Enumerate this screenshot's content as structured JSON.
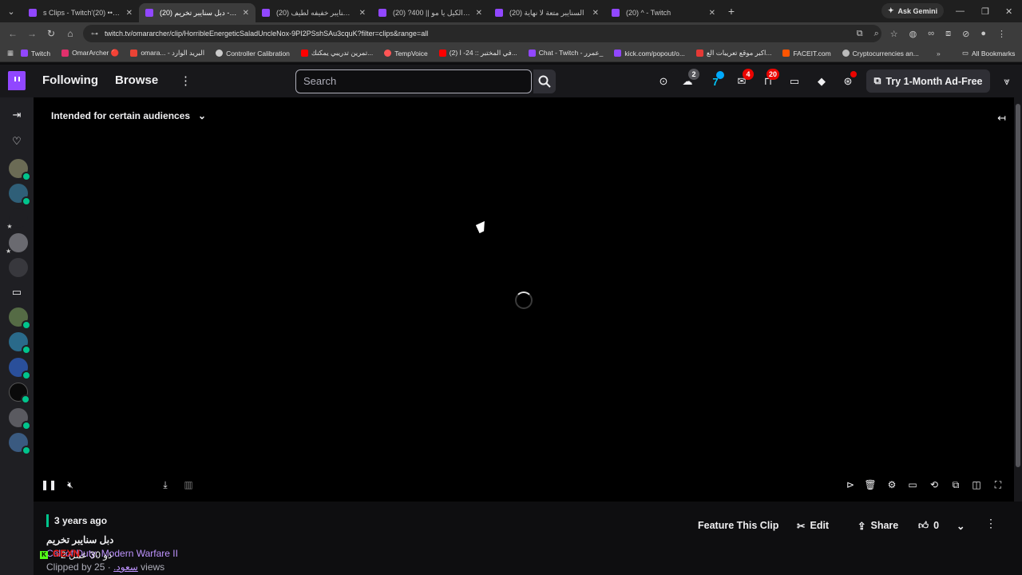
{
  "browser": {
    "tabs": [
      {
        "title": "s Clips - Twitch'عمر•• (20)",
        "active": false
      },
      {
        "title": "(20) دبل سنايبر تخريم - witch",
        "active": true
      },
      {
        "title": "(20) لقطة سنايبر خفيفه لطيف",
        "active": false
      },
      {
        "title": "(20) ?400 || طفع الكيل يا مو",
        "active": false
      },
      {
        "title": "(20) السنايبر متعة لا نهاية",
        "active": false
      },
      {
        "title": "(20) ^ - Twitch",
        "active": false
      }
    ],
    "ask_gemini": "Ask Gemini",
    "url": "twitch.tv/omararcher/clip/HorribleEnergeticSaladUncleNox-9PI2PSshSAu3cquK?filter=clips&range=all",
    "bookmarks": [
      {
        "label": "Twitch",
        "color": "#9147ff"
      },
      {
        "label": "OmarArcher 🔴",
        "color": "#e1306c"
      },
      {
        "label": "omara... - البريد الوارد",
        "color": "#ea4335"
      },
      {
        "label": "Controller Calibration",
        "color": "#cccccc"
      },
      {
        "label": "تمرين تدريبي يمكنك...",
        "color": "#ff0000"
      },
      {
        "label": "TempVoice",
        "color": "#ff5555"
      },
      {
        "label": "(2) في المختبر :: 24- ا...",
        "color": "#ff0000"
      },
      {
        "label": "Chat - Twitch - عمرر_",
        "color": "#9147ff"
      },
      {
        "label": "kick.com/popout/o...",
        "color": "#9147ff"
      },
      {
        "label": "اكبر موقع تعريبات الع...",
        "color": "#e53935"
      },
      {
        "label": "FACEIT.com",
        "color": "#ff5500"
      },
      {
        "label": "Cryptocurrencies an...",
        "color": "#bbbbbb"
      }
    ],
    "all_bookmarks": "All Bookmarks"
  },
  "topnav": {
    "following": "Following",
    "browse": "Browse",
    "search_placeholder": "Search",
    "badges": {
      "drops": "2",
      "notifications": "4",
      "inbox": "20"
    },
    "ad_free": "Try 1-Month Ad-Free"
  },
  "player": {
    "audience_label": "Intended for certain audiences"
  },
  "clip": {
    "age": "3 years ago",
    "title": "دبل سنايبر تخريم",
    "game": "Call of Duty: Modern Warfare II",
    "clipped_by_prefix": "Clipped by",
    "clipper": "سعود.",
    "views": "· 25 views",
    "overlay_brand": "GEXN",
    "overlay_date": "2 ذو 30 عمل"
  },
  "actions": {
    "feature": "Feature This Clip",
    "edit": "Edit",
    "share": "Share",
    "likes": "0"
  },
  "colors": {
    "twitch_purple": "#9147ff",
    "live_green": "#00c48c",
    "badge_red": "#eb0400"
  }
}
